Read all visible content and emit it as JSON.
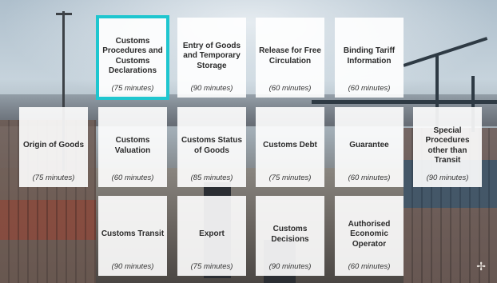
{
  "modules": {
    "row1": [
      {
        "title": "Customs Procedures and Customs Declarations",
        "duration": "(75 minutes)"
      },
      {
        "title": "Entry of Goods and Temporary Storage",
        "duration": "(90 minutes)"
      },
      {
        "title": "Release for Free Circulation",
        "duration": "(60 minutes)"
      },
      {
        "title": "Binding Tariff Information",
        "duration": "(60 minutes)"
      }
    ],
    "row2": [
      {
        "title": "Origin of Goods",
        "duration": "(75 minutes)"
      },
      {
        "title": "Customs Valuation",
        "duration": "(60 minutes)"
      },
      {
        "title": "Customs Status of Goods",
        "duration": "(85 minutes)"
      },
      {
        "title": "Customs Debt",
        "duration": "(75 minutes)"
      },
      {
        "title": "Guarantee",
        "duration": "(60 minutes)"
      },
      {
        "title": "Special Procedures other than Transit",
        "duration": "(90 minutes)"
      }
    ],
    "row3": [
      {
        "title": "Customs Transit",
        "duration": "(90 minutes)"
      },
      {
        "title": "Export",
        "duration": "(75 minutes)"
      },
      {
        "title": "Customs Decisions",
        "duration": "(90 minutes)"
      },
      {
        "title": "Authorised Economic Operator",
        "duration": "(60 minutes)"
      }
    ]
  },
  "colors": {
    "selection_border": "#1fc6cf",
    "tile_background": "#ffffff"
  }
}
